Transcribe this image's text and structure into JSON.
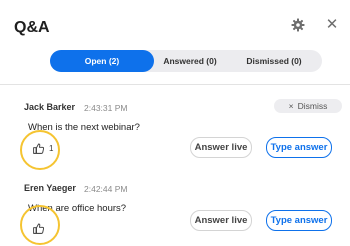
{
  "header": {
    "title": "Q&A"
  },
  "icons": {
    "settings": "gear-icon",
    "close": "close-icon",
    "like": "thumbs-up-icon"
  },
  "tabs": [
    {
      "label": "Open (2)",
      "active": true
    },
    {
      "label": "Answered (0)",
      "active": false
    },
    {
      "label": "Dismissed (0)",
      "active": false
    }
  ],
  "questions": [
    {
      "author": "Jack Barker",
      "time": "2:43:31 PM",
      "text": "When is the next webinar?",
      "likes": "1",
      "dismiss_label": "Dismiss",
      "answer_live_label": "Answer live",
      "type_answer_label": "Type answer"
    },
    {
      "author": "Eren Yaeger",
      "time": "2:42:44 PM",
      "text": "When are office hours?",
      "likes": "",
      "answer_live_label": "Answer live",
      "type_answer_label": "Type answer"
    }
  ],
  "colors": {
    "accent": "#0e71eb",
    "highlight_ring": "#f5c431",
    "tab_track": "#ececef"
  }
}
